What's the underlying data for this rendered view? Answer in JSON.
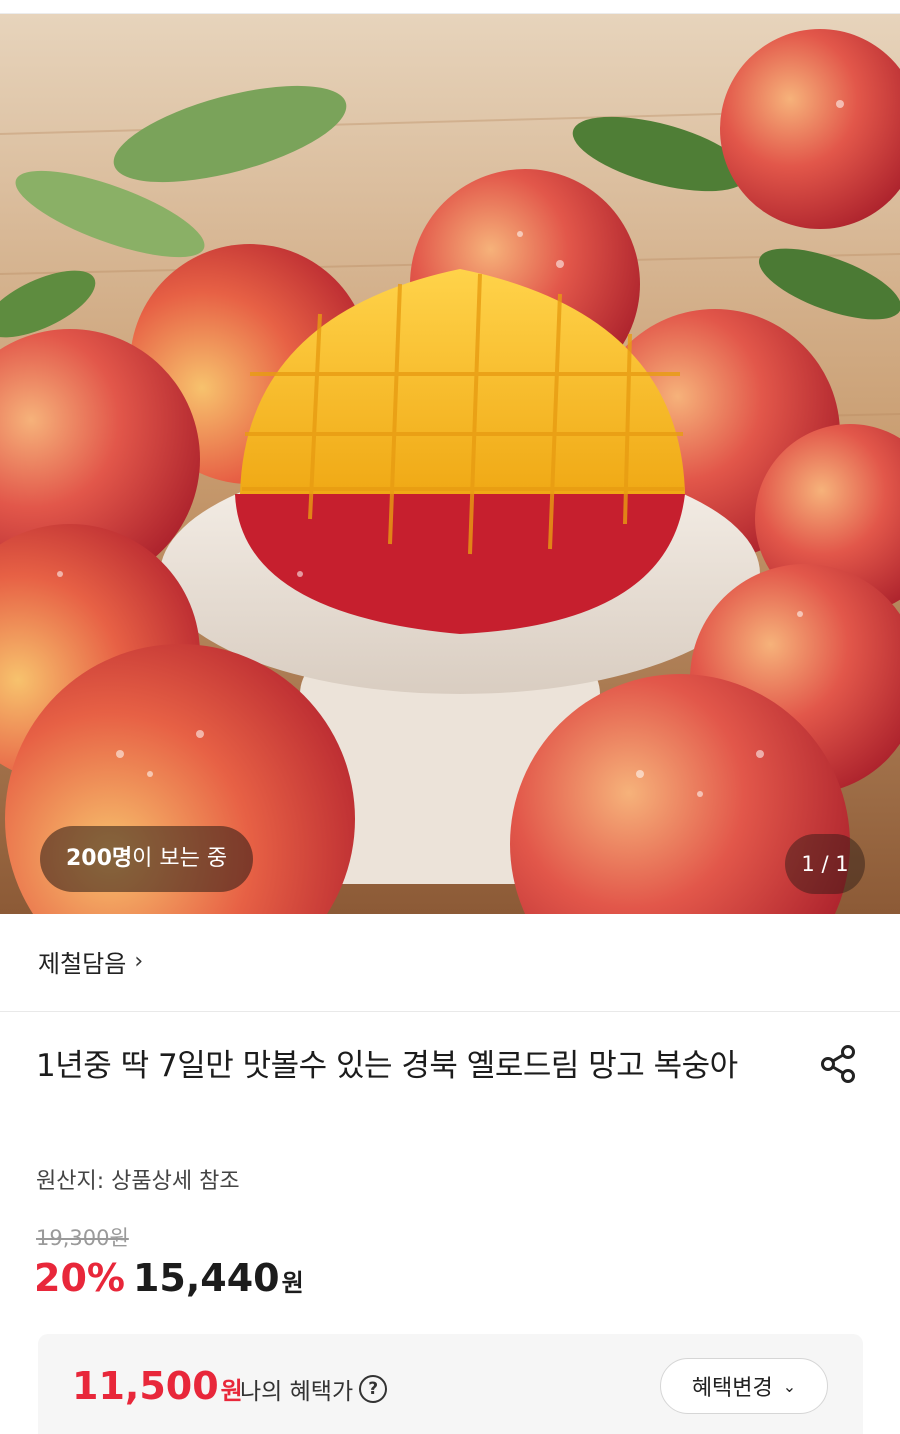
{
  "hero": {
    "image_subject": "mango-peach-product-photo",
    "viewers_count": "200명",
    "viewers_suffix": "이 보는 중",
    "counter": "1 / 1"
  },
  "store": {
    "name": "제철담음",
    "chevron": "›"
  },
  "product": {
    "title": "1년중 딱 7일만 맛볼수 있는 경북 옐로드림 망고 복숭아",
    "origin": "원산지: 상품상세 참조",
    "original_price": "19,300원",
    "discount_rate": "20%",
    "sale_price": "15,440",
    "sale_unit": "원"
  },
  "benefit": {
    "price": "11,500",
    "unit": "원",
    "label": "나의 혜택가",
    "help_glyph": "?",
    "change_label": "혜택변경",
    "change_chevron": "⌄"
  },
  "colors": {
    "accent_red": "#e8273a",
    "text": "#1c1c1c",
    "muted": "#9a9a9a"
  },
  "icons": [
    "share-icon",
    "help-icon",
    "chevron-right-icon",
    "chevron-down-icon"
  ]
}
